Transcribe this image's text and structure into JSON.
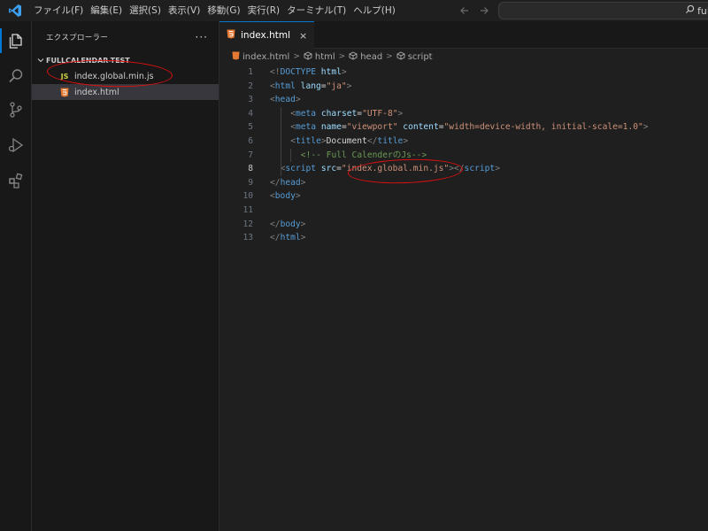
{
  "menu": [
    "ファイル(F)",
    "編集(E)",
    "選択(S)",
    "表示(V)",
    "移動(G)",
    "実行(R)",
    "ターミナル(T)",
    "ヘルプ(H)"
  ],
  "command_center": {
    "text": "full"
  },
  "sidebar": {
    "title": "エクスプローラー",
    "more": "···",
    "folder": "FULLCALENDAR-TEST",
    "files": [
      {
        "icon": "JS",
        "name": "index.global.min.js"
      },
      {
        "name": "index.html"
      }
    ]
  },
  "editor": {
    "tab": {
      "label": "index.html",
      "close": "×"
    },
    "breadcrumb": [
      "index.html",
      "html",
      "head",
      "script"
    ],
    "lines": [
      {
        "n": "1",
        "indent": 0,
        "parts": [
          [
            "t",
            "<!"
          ],
          [
            "tag",
            "DOCTYPE "
          ],
          [
            "attr",
            "html"
          ],
          [
            "t",
            ">"
          ]
        ]
      },
      {
        "n": "2",
        "indent": 0,
        "parts": [
          [
            "t",
            "<"
          ],
          [
            "tag",
            "html "
          ],
          [
            "attr",
            "lang"
          ],
          [
            "txt",
            "="
          ],
          [
            "str",
            "\"ja\""
          ],
          [
            "t",
            ">"
          ]
        ]
      },
      {
        "n": "3",
        "indent": 0,
        "parts": [
          [
            "t",
            "<"
          ],
          [
            "tag",
            "head"
          ],
          [
            "t",
            ">"
          ]
        ]
      },
      {
        "n": "4",
        "indent": 4,
        "parts": [
          [
            "t",
            "<"
          ],
          [
            "tag",
            "meta "
          ],
          [
            "attr",
            "charset"
          ],
          [
            "txt",
            "="
          ],
          [
            "str",
            "\"UTF-8\""
          ],
          [
            "t",
            ">"
          ]
        ]
      },
      {
        "n": "5",
        "indent": 4,
        "parts": [
          [
            "t",
            "<"
          ],
          [
            "tag",
            "meta "
          ],
          [
            "attr",
            "name"
          ],
          [
            "txt",
            "="
          ],
          [
            "str",
            "\"viewport\""
          ],
          [
            "txt",
            " "
          ],
          [
            "attr",
            "content"
          ],
          [
            "txt",
            "="
          ],
          [
            "str",
            "\"width=device-width, initial-scale=1.0\""
          ],
          [
            "t",
            ">"
          ]
        ]
      },
      {
        "n": "6",
        "indent": 4,
        "parts": [
          [
            "t",
            "<"
          ],
          [
            "tag",
            "title"
          ],
          [
            "t",
            ">"
          ],
          [
            "txt",
            "Document"
          ],
          [
            "t",
            "</"
          ],
          [
            "tag",
            "title"
          ],
          [
            "t",
            ">"
          ]
        ]
      },
      {
        "n": "7",
        "indent": 6,
        "parts": [
          [
            "cmt",
            "<!-- Full CalenderのJs-->"
          ]
        ]
      },
      {
        "n": "8",
        "indent": 2,
        "parts": [
          [
            "t",
            "<"
          ],
          [
            "tag",
            "script "
          ],
          [
            "attr",
            "src"
          ],
          [
            "txt",
            "="
          ],
          [
            "str",
            "\"index.global.min.js\""
          ],
          [
            "t",
            "></"
          ],
          [
            "tag",
            "script"
          ],
          [
            "t",
            ">"
          ]
        ]
      },
      {
        "n": "9",
        "indent": 0,
        "parts": [
          [
            "t",
            "</"
          ],
          [
            "tag",
            "head"
          ],
          [
            "t",
            ">"
          ]
        ]
      },
      {
        "n": "10",
        "indent": 0,
        "parts": [
          [
            "t",
            "<"
          ],
          [
            "tag",
            "body"
          ],
          [
            "t",
            ">"
          ]
        ]
      },
      {
        "n": "11",
        "indent": 0,
        "parts": []
      },
      {
        "n": "12",
        "indent": 0,
        "parts": [
          [
            "t",
            "</"
          ],
          [
            "tag",
            "body"
          ],
          [
            "t",
            ">"
          ]
        ]
      },
      {
        "n": "13",
        "indent": 0,
        "parts": [
          [
            "t",
            "</"
          ],
          [
            "tag",
            "html"
          ],
          [
            "t",
            ">"
          ]
        ]
      }
    ],
    "active_line": "8"
  },
  "colors": {
    "accent": "#0078d4",
    "annotation": "#e01010",
    "html_icon": "#e37933",
    "js_icon": "#cbcb41"
  }
}
